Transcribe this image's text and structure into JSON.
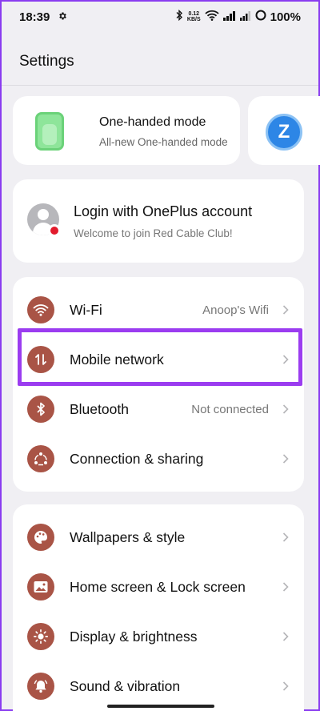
{
  "status_bar": {
    "time": "18:39",
    "speed_value": "0.12",
    "speed_unit": "KB/S",
    "battery": "100%"
  },
  "page": {
    "title": "Settings"
  },
  "promo": {
    "title": "One-handed mode",
    "subtitle": "All-new One-handed mode",
    "second_card_letter": "Z"
  },
  "account": {
    "title": "Login with OnePlus account",
    "subtitle": "Welcome to join Red Cable Club!"
  },
  "groups": [
    {
      "items": [
        {
          "label": "Wi-Fi",
          "value": "Anoop's Wifi",
          "icon": "wifi-icon"
        },
        {
          "label": "Mobile network",
          "value": "",
          "icon": "mobile-data-icon"
        },
        {
          "label": "Bluetooth",
          "value": "Not connected",
          "icon": "bluetooth-icon"
        },
        {
          "label": "Connection & sharing",
          "value": "",
          "icon": "connection-icon"
        }
      ]
    },
    {
      "items": [
        {
          "label": "Wallpapers & style",
          "value": "",
          "icon": "palette-icon"
        },
        {
          "label": "Home screen & Lock screen",
          "value": "",
          "icon": "image-icon"
        },
        {
          "label": "Display & brightness",
          "value": "",
          "icon": "brightness-icon"
        },
        {
          "label": "Sound & vibration",
          "value": "",
          "icon": "bell-icon"
        }
      ]
    }
  ],
  "colors": {
    "icon_bg": "#a95446",
    "highlight": "#9b3cf0",
    "page_bg": "#f0eff3"
  }
}
